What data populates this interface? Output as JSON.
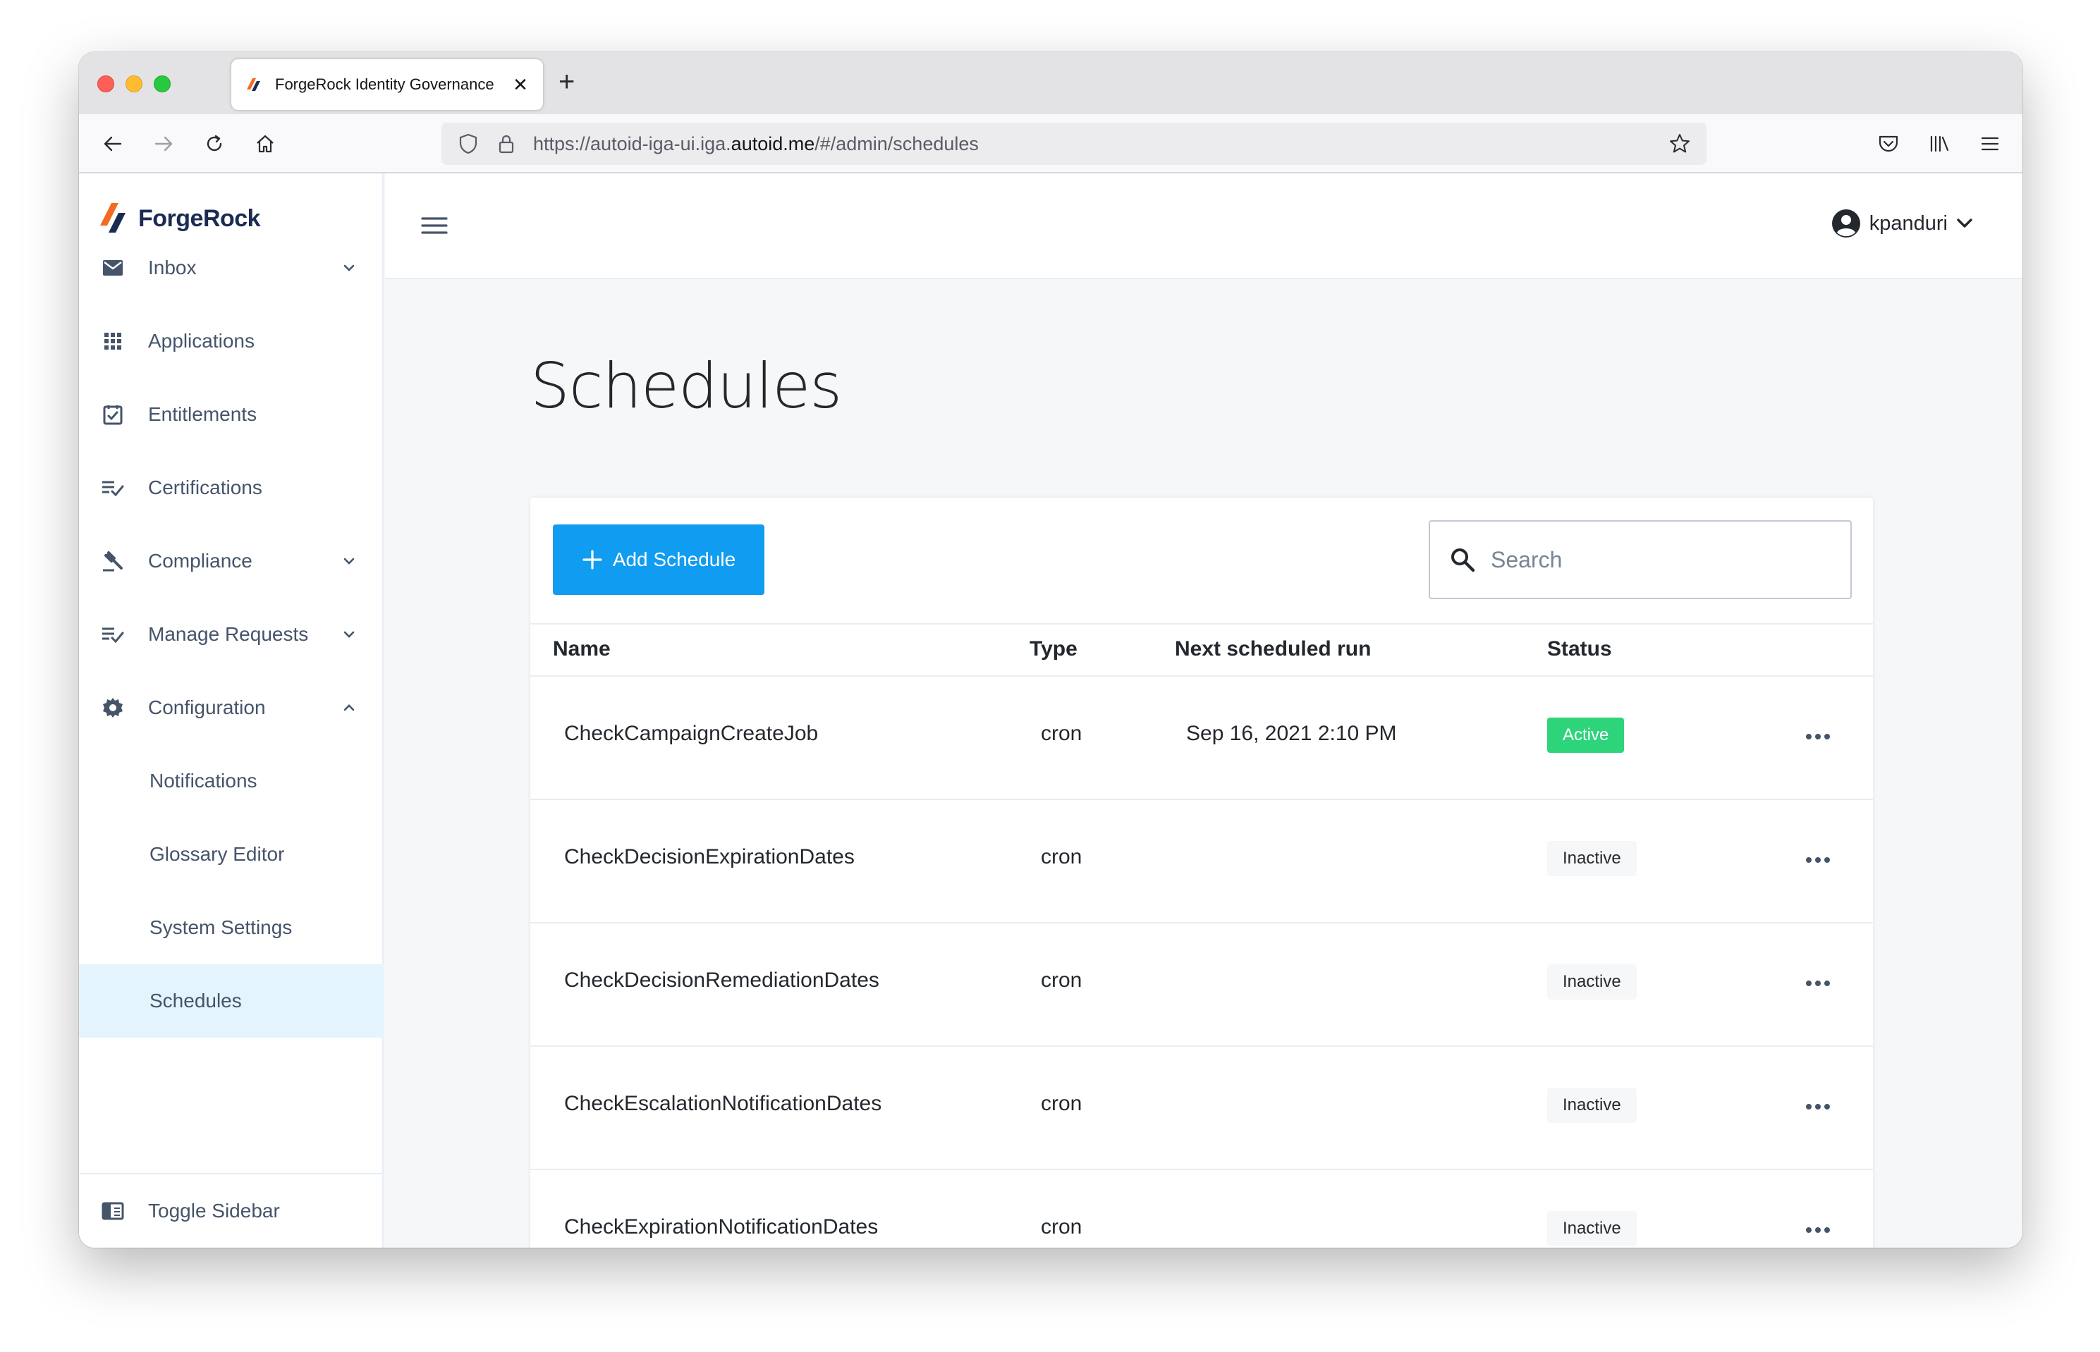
{
  "browser": {
    "tab_title": "ForgeRock Identity Governance",
    "url_prefix": "https://autoid-iga-ui.iga.",
    "url_host": "autoid.me",
    "url_suffix": "/#/admin/schedules"
  },
  "brand": {
    "name": "ForgeRock"
  },
  "sidebar": {
    "items": [
      {
        "label": "Inbox",
        "icon": "mail-icon",
        "chevron": "down"
      },
      {
        "label": "Applications",
        "icon": "apps-grid-icon"
      },
      {
        "label": "Entitlements",
        "icon": "checkbox-icon"
      },
      {
        "label": "Certifications",
        "icon": "list-check-icon"
      },
      {
        "label": "Compliance",
        "icon": "gavel-icon",
        "chevron": "down"
      },
      {
        "label": "Manage Requests",
        "icon": "list-check-icon",
        "chevron": "down"
      },
      {
        "label": "Configuration",
        "icon": "gear-icon",
        "chevron": "up"
      }
    ],
    "sub_items": [
      {
        "label": "Notifications"
      },
      {
        "label": "Glossary Editor"
      },
      {
        "label": "System Settings"
      },
      {
        "label": "Schedules",
        "active": true
      }
    ],
    "footer_label": "Toggle Sidebar"
  },
  "header": {
    "username": "kpanduri"
  },
  "page": {
    "title": "Schedules",
    "add_button_label": "Add Schedule",
    "search_placeholder": "Search"
  },
  "table": {
    "columns": [
      "Name",
      "Type",
      "Next scheduled run",
      "Status"
    ],
    "rows": [
      {
        "name": "CheckCampaignCreateJob",
        "type": "cron",
        "next_run": "Sep 16, 2021 2:10 PM",
        "status": "Active"
      },
      {
        "name": "CheckDecisionExpirationDates",
        "type": "cron",
        "next_run": "",
        "status": "Inactive"
      },
      {
        "name": "CheckDecisionRemediationDates",
        "type": "cron",
        "next_run": "",
        "status": "Inactive"
      },
      {
        "name": "CheckEscalationNotificationDates",
        "type": "cron",
        "next_run": "",
        "status": "Inactive"
      },
      {
        "name": "CheckExpirationNotificationDates",
        "type": "cron",
        "next_run": "",
        "status": "Inactive"
      }
    ]
  },
  "colors": {
    "primary": "#109cf1",
    "active_badge": "#2ed47a",
    "brand_orange": "#f26b21",
    "brand_navy": "#1c2b52",
    "selected_bg": "#e4f4fd"
  }
}
